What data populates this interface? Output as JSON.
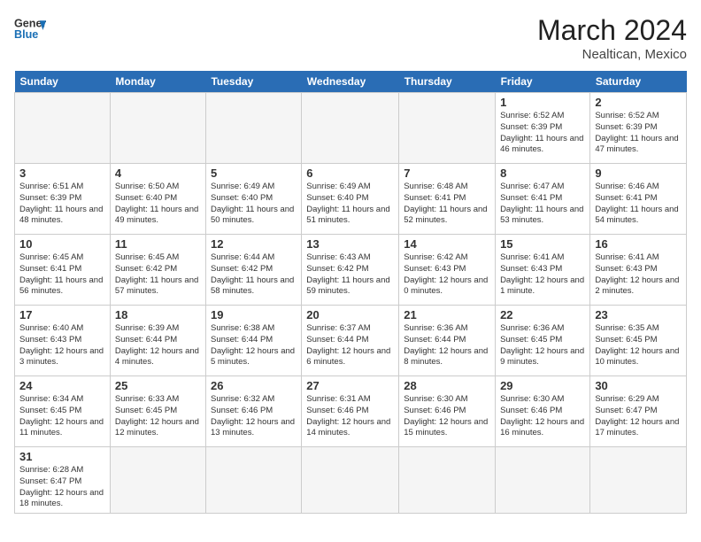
{
  "header": {
    "logo_general": "General",
    "logo_blue": "Blue",
    "month_year": "March 2024",
    "location": "Nealtican, Mexico"
  },
  "days_of_week": [
    "Sunday",
    "Monday",
    "Tuesday",
    "Wednesday",
    "Thursday",
    "Friday",
    "Saturday"
  ],
  "weeks": [
    [
      {
        "day": "",
        "info": ""
      },
      {
        "day": "",
        "info": ""
      },
      {
        "day": "",
        "info": ""
      },
      {
        "day": "",
        "info": ""
      },
      {
        "day": "",
        "info": ""
      },
      {
        "day": "1",
        "info": "Sunrise: 6:52 AM\nSunset: 6:39 PM\nDaylight: 11 hours and 46 minutes."
      },
      {
        "day": "2",
        "info": "Sunrise: 6:52 AM\nSunset: 6:39 PM\nDaylight: 11 hours and 47 minutes."
      }
    ],
    [
      {
        "day": "3",
        "info": "Sunrise: 6:51 AM\nSunset: 6:39 PM\nDaylight: 11 hours and 48 minutes."
      },
      {
        "day": "4",
        "info": "Sunrise: 6:50 AM\nSunset: 6:40 PM\nDaylight: 11 hours and 49 minutes."
      },
      {
        "day": "5",
        "info": "Sunrise: 6:49 AM\nSunset: 6:40 PM\nDaylight: 11 hours and 50 minutes."
      },
      {
        "day": "6",
        "info": "Sunrise: 6:49 AM\nSunset: 6:40 PM\nDaylight: 11 hours and 51 minutes."
      },
      {
        "day": "7",
        "info": "Sunrise: 6:48 AM\nSunset: 6:41 PM\nDaylight: 11 hours and 52 minutes."
      },
      {
        "day": "8",
        "info": "Sunrise: 6:47 AM\nSunset: 6:41 PM\nDaylight: 11 hours and 53 minutes."
      },
      {
        "day": "9",
        "info": "Sunrise: 6:46 AM\nSunset: 6:41 PM\nDaylight: 11 hours and 54 minutes."
      }
    ],
    [
      {
        "day": "10",
        "info": "Sunrise: 6:45 AM\nSunset: 6:41 PM\nDaylight: 11 hours and 56 minutes."
      },
      {
        "day": "11",
        "info": "Sunrise: 6:45 AM\nSunset: 6:42 PM\nDaylight: 11 hours and 57 minutes."
      },
      {
        "day": "12",
        "info": "Sunrise: 6:44 AM\nSunset: 6:42 PM\nDaylight: 11 hours and 58 minutes."
      },
      {
        "day": "13",
        "info": "Sunrise: 6:43 AM\nSunset: 6:42 PM\nDaylight: 11 hours and 59 minutes."
      },
      {
        "day": "14",
        "info": "Sunrise: 6:42 AM\nSunset: 6:43 PM\nDaylight: 12 hours and 0 minutes."
      },
      {
        "day": "15",
        "info": "Sunrise: 6:41 AM\nSunset: 6:43 PM\nDaylight: 12 hours and 1 minute."
      },
      {
        "day": "16",
        "info": "Sunrise: 6:41 AM\nSunset: 6:43 PM\nDaylight: 12 hours and 2 minutes."
      }
    ],
    [
      {
        "day": "17",
        "info": "Sunrise: 6:40 AM\nSunset: 6:43 PM\nDaylight: 12 hours and 3 minutes."
      },
      {
        "day": "18",
        "info": "Sunrise: 6:39 AM\nSunset: 6:44 PM\nDaylight: 12 hours and 4 minutes."
      },
      {
        "day": "19",
        "info": "Sunrise: 6:38 AM\nSunset: 6:44 PM\nDaylight: 12 hours and 5 minutes."
      },
      {
        "day": "20",
        "info": "Sunrise: 6:37 AM\nSunset: 6:44 PM\nDaylight: 12 hours and 6 minutes."
      },
      {
        "day": "21",
        "info": "Sunrise: 6:36 AM\nSunset: 6:44 PM\nDaylight: 12 hours and 8 minutes."
      },
      {
        "day": "22",
        "info": "Sunrise: 6:36 AM\nSunset: 6:45 PM\nDaylight: 12 hours and 9 minutes."
      },
      {
        "day": "23",
        "info": "Sunrise: 6:35 AM\nSunset: 6:45 PM\nDaylight: 12 hours and 10 minutes."
      }
    ],
    [
      {
        "day": "24",
        "info": "Sunrise: 6:34 AM\nSunset: 6:45 PM\nDaylight: 12 hours and 11 minutes."
      },
      {
        "day": "25",
        "info": "Sunrise: 6:33 AM\nSunset: 6:45 PM\nDaylight: 12 hours and 12 minutes."
      },
      {
        "day": "26",
        "info": "Sunrise: 6:32 AM\nSunset: 6:46 PM\nDaylight: 12 hours and 13 minutes."
      },
      {
        "day": "27",
        "info": "Sunrise: 6:31 AM\nSunset: 6:46 PM\nDaylight: 12 hours and 14 minutes."
      },
      {
        "day": "28",
        "info": "Sunrise: 6:30 AM\nSunset: 6:46 PM\nDaylight: 12 hours and 15 minutes."
      },
      {
        "day": "29",
        "info": "Sunrise: 6:30 AM\nSunset: 6:46 PM\nDaylight: 12 hours and 16 minutes."
      },
      {
        "day": "30",
        "info": "Sunrise: 6:29 AM\nSunset: 6:47 PM\nDaylight: 12 hours and 17 minutes."
      }
    ],
    [
      {
        "day": "31",
        "info": "Sunrise: 6:28 AM\nSunset: 6:47 PM\nDaylight: 12 hours and 18 minutes."
      },
      {
        "day": "",
        "info": ""
      },
      {
        "day": "",
        "info": ""
      },
      {
        "day": "",
        "info": ""
      },
      {
        "day": "",
        "info": ""
      },
      {
        "day": "",
        "info": ""
      },
      {
        "day": "",
        "info": ""
      }
    ]
  ]
}
